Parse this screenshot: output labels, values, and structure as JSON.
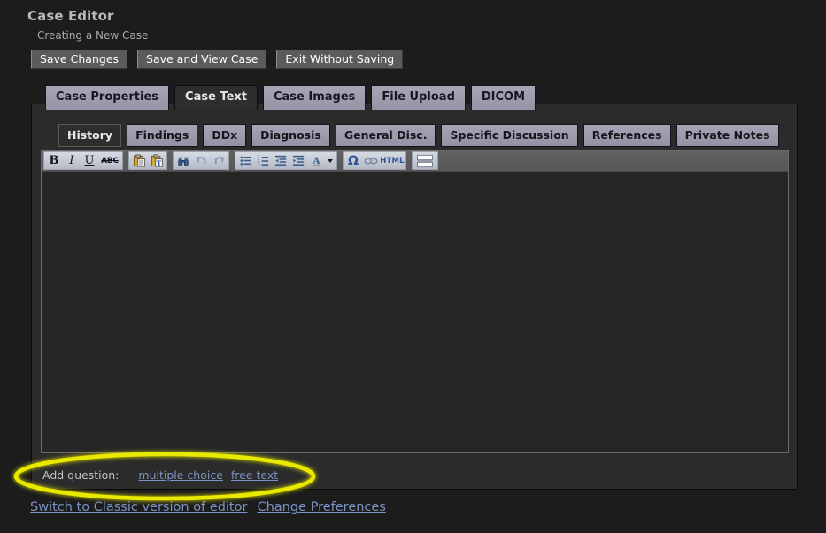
{
  "header": {
    "title": "Case Editor",
    "subtitle": "Creating a New Case",
    "buttons": [
      {
        "label": "Save Changes",
        "name": "save-changes-button"
      },
      {
        "label": "Save and View Case",
        "name": "save-and-view-case-button"
      },
      {
        "label": "Exit Without Saving",
        "name": "exit-without-saving-button"
      }
    ]
  },
  "tabs": [
    {
      "label": "Case Properties",
      "active": false
    },
    {
      "label": "Case Text",
      "active": true
    },
    {
      "label": "Case Images",
      "active": false
    },
    {
      "label": "File Upload",
      "active": false
    },
    {
      "label": "DICOM",
      "active": false
    }
  ],
  "subtabs": [
    {
      "label": "History",
      "active": true
    },
    {
      "label": "Findings",
      "active": false
    },
    {
      "label": "DDx",
      "active": false
    },
    {
      "label": "Diagnosis",
      "active": false
    },
    {
      "label": "General Disc.",
      "active": false
    },
    {
      "label": "Specific Discussion",
      "active": false
    },
    {
      "label": "References",
      "active": false
    },
    {
      "label": "Private Notes",
      "active": false
    }
  ],
  "toolbar": {
    "groups": [
      {
        "name": "formatting",
        "buttons": [
          {
            "name": "bold-icon",
            "glyph": "B",
            "style": "bold",
            "disabled": false
          },
          {
            "name": "italic-icon",
            "glyph": "I",
            "style": "italic",
            "disabled": false
          },
          {
            "name": "underline-icon",
            "glyph": "U",
            "style": "underline",
            "disabled": false
          },
          {
            "name": "strikethrough-icon",
            "glyph": "ABC",
            "style": "strike",
            "disabled": false
          }
        ]
      },
      {
        "name": "clipboard",
        "buttons": [
          {
            "name": "paste-icon",
            "glyph": "",
            "style": "svg-paste",
            "disabled": false
          },
          {
            "name": "paste-as-text-icon",
            "glyph": "",
            "style": "svg-paste-text",
            "disabled": false
          }
        ]
      },
      {
        "name": "history",
        "buttons": [
          {
            "name": "find-replace-icon",
            "glyph": "",
            "style": "svg-binoculars",
            "disabled": false
          },
          {
            "name": "undo-icon",
            "glyph": "",
            "style": "svg-undo",
            "disabled": true
          },
          {
            "name": "redo-icon",
            "glyph": "",
            "style": "svg-redo",
            "disabled": true
          }
        ]
      },
      {
        "name": "paragraph",
        "buttons": [
          {
            "name": "bulleted-list-icon",
            "glyph": "",
            "style": "svg-ul",
            "disabled": false
          },
          {
            "name": "numbered-list-icon",
            "glyph": "",
            "style": "svg-ol",
            "disabled": false
          },
          {
            "name": "outdent-icon",
            "glyph": "",
            "style": "svg-outdent",
            "disabled": false
          },
          {
            "name": "indent-icon",
            "glyph": "",
            "style": "svg-indent",
            "disabled": false
          },
          {
            "name": "text-color-icon",
            "glyph": "A",
            "style": "svg-textcolor",
            "disabled": false
          },
          {
            "name": "text-color-dropdown-icon",
            "glyph": "",
            "style": "caret",
            "disabled": false
          }
        ]
      },
      {
        "name": "insert",
        "buttons": [
          {
            "name": "special-character-icon",
            "glyph": "Ω",
            "style": "omega",
            "disabled": false
          },
          {
            "name": "insert-link-icon",
            "glyph": "",
            "style": "svg-link",
            "disabled": false
          },
          {
            "name": "edit-html-source-icon",
            "glyph": "HTML",
            "style": "html",
            "disabled": false
          }
        ]
      },
      {
        "name": "layout",
        "buttons": [
          {
            "name": "split-view-icon",
            "glyph": "",
            "style": "svg-split",
            "disabled": false
          }
        ]
      }
    ]
  },
  "editor": {
    "content": "",
    "placeholder": ""
  },
  "add_question": {
    "label": "Add question:",
    "links": [
      {
        "label": "multiple choice",
        "name": "add-multiple-choice-question-link"
      },
      {
        "label": "free text",
        "name": "add-free-text-question-link"
      }
    ]
  },
  "footer_links": [
    {
      "label": "Switch to Classic version of editor",
      "name": "switch-to-classic-editor-link"
    },
    {
      "label": "Change Preferences",
      "name": "change-preferences-link"
    }
  ],
  "annotation": {
    "shape": "ellipse",
    "color": "#e9e900",
    "target": "add-question-row"
  },
  "colors": {
    "background": "#1c1c1c",
    "panel": "#2b2b2b",
    "tab_active": "#2e2e2e",
    "tab_inactive": "#9b9bac",
    "link": "#7b93c4",
    "annotation": "#e9e900"
  }
}
